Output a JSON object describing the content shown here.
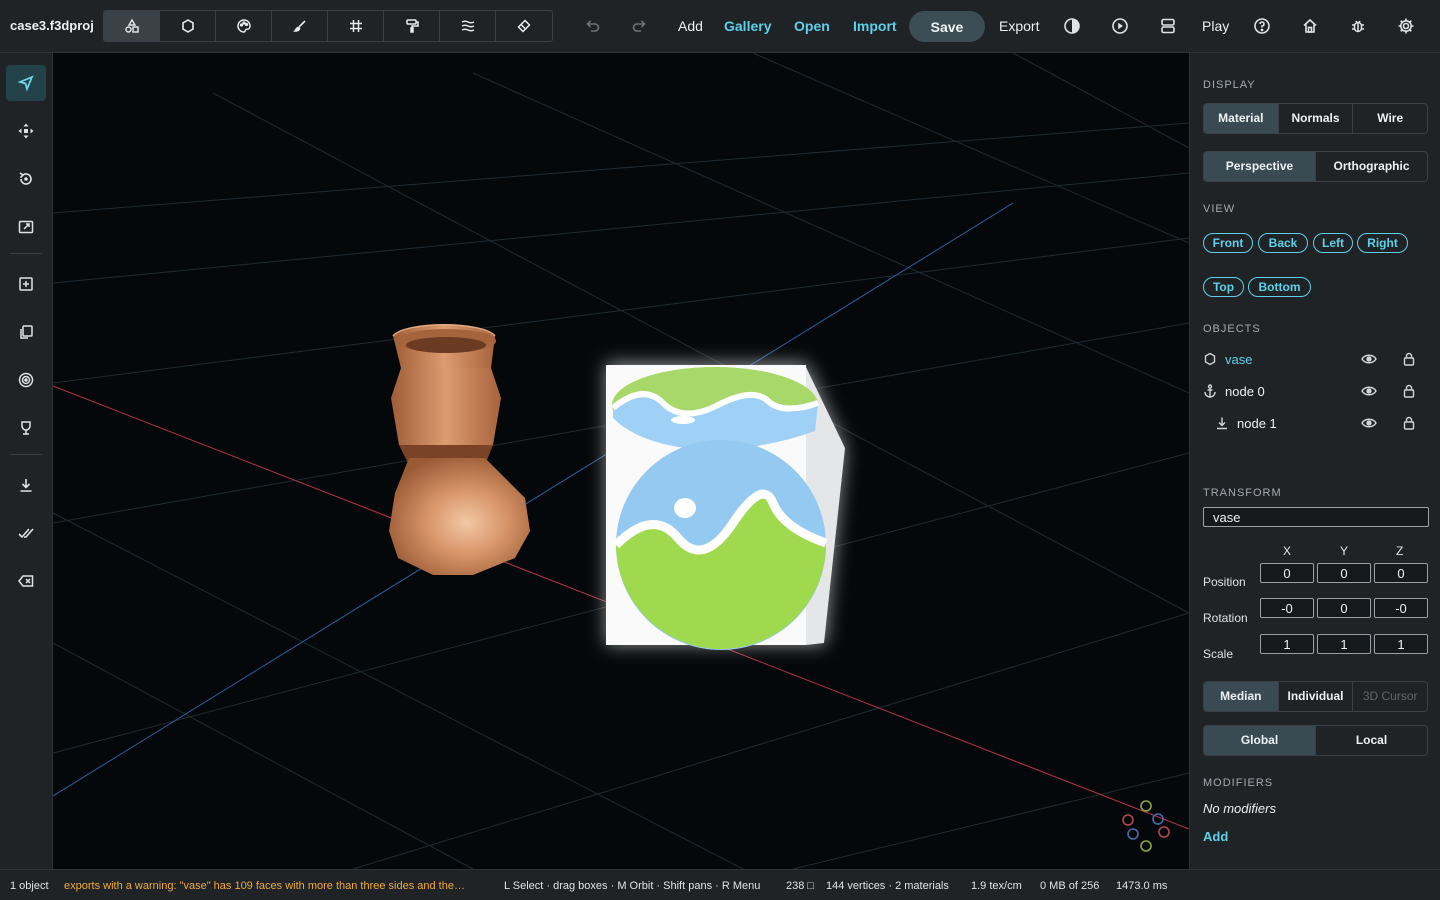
{
  "app": {
    "project_name": "case3.f3dproj"
  },
  "toolbar": {
    "tools": [
      {
        "name": "objects-tool",
        "icon": "shapes-icon"
      },
      {
        "name": "shape-tool",
        "icon": "circle-icon"
      },
      {
        "name": "material-tool",
        "icon": "palette-icon"
      },
      {
        "name": "brush-tool",
        "icon": "brush-icon"
      },
      {
        "name": "grid-tool",
        "icon": "grid-icon"
      },
      {
        "name": "paint-roller-tool",
        "icon": "paint-roller-icon"
      },
      {
        "name": "lines-tool",
        "icon": "lines-icon"
      },
      {
        "name": "eraser-tool",
        "icon": "eraser-icon"
      }
    ],
    "add_label": "Add",
    "gallery_label": "Gallery",
    "open_label": "Open",
    "import_label": "Import",
    "save_label": "Save",
    "export_label": "Export",
    "play_label": "Play"
  },
  "left_toolbar": [
    "select-tool",
    "move-tool",
    "rotate-tool",
    "scale-tool",
    "add-tool",
    "duplicate-tool",
    "target-tool",
    "material-tool",
    "download-tool",
    "check-tool",
    "delete-tool"
  ],
  "panel": {
    "display_title": "DISPLAY",
    "display_modes": [
      "Material",
      "Normals",
      "Wire"
    ],
    "display_active": "Material",
    "projection_modes": [
      "Perspective",
      "Orthographic"
    ],
    "projection_active": "Perspective",
    "view_title": "VIEW",
    "views_row1": [
      "Front",
      "Back",
      "Left",
      "Right"
    ],
    "views_row2": [
      "Top",
      "Bottom"
    ],
    "objects_title": "OBJECTS",
    "objects": [
      {
        "name": "vase",
        "icon": "circle-icon",
        "selected": true
      },
      {
        "name": "node 0",
        "icon": "anchor-icon",
        "selected": false
      },
      {
        "name": "node 1",
        "icon": "download-icon",
        "selected": false
      }
    ],
    "transform_title": "TRANSFORM",
    "transform_name": "vase",
    "axes": [
      "X",
      "Y",
      "Z"
    ],
    "position_label": "Position",
    "rotation_label": "Rotation",
    "scale_label": "Scale",
    "position": [
      "0",
      "0",
      "0"
    ],
    "rotation": [
      "-0",
      "0",
      "-0"
    ],
    "scale": [
      "1",
      "1",
      "1"
    ],
    "pivot_modes": [
      "Median",
      "Individual",
      "3D Cursor"
    ],
    "pivot_active": "Median",
    "space_modes": [
      "Global",
      "Local"
    ],
    "space_active": "Global",
    "modifiers_title": "MODIFIERS",
    "no_modifiers": "No modifiers",
    "add_modifier": "Add"
  },
  "status": {
    "object_count": "1 object",
    "warning": "exports with a warning: \"vase\" has 109 faces with more than three sides and the…",
    "hints": "L Select · drag boxes · M Orbit · Shift pans · R Menu",
    "faces": "238 □",
    "geometry": "144 vertices · 2 materials",
    "texel": "1.9 tex/cm",
    "memory": "0 MB of 256",
    "time": "1473.0 ms"
  },
  "colors": {
    "accent": "#5fd0ea",
    "warning": "#f2a93b",
    "vase": "#c98457",
    "cube_green": "#9ed84a",
    "cube_blue": "#90c8f2"
  }
}
